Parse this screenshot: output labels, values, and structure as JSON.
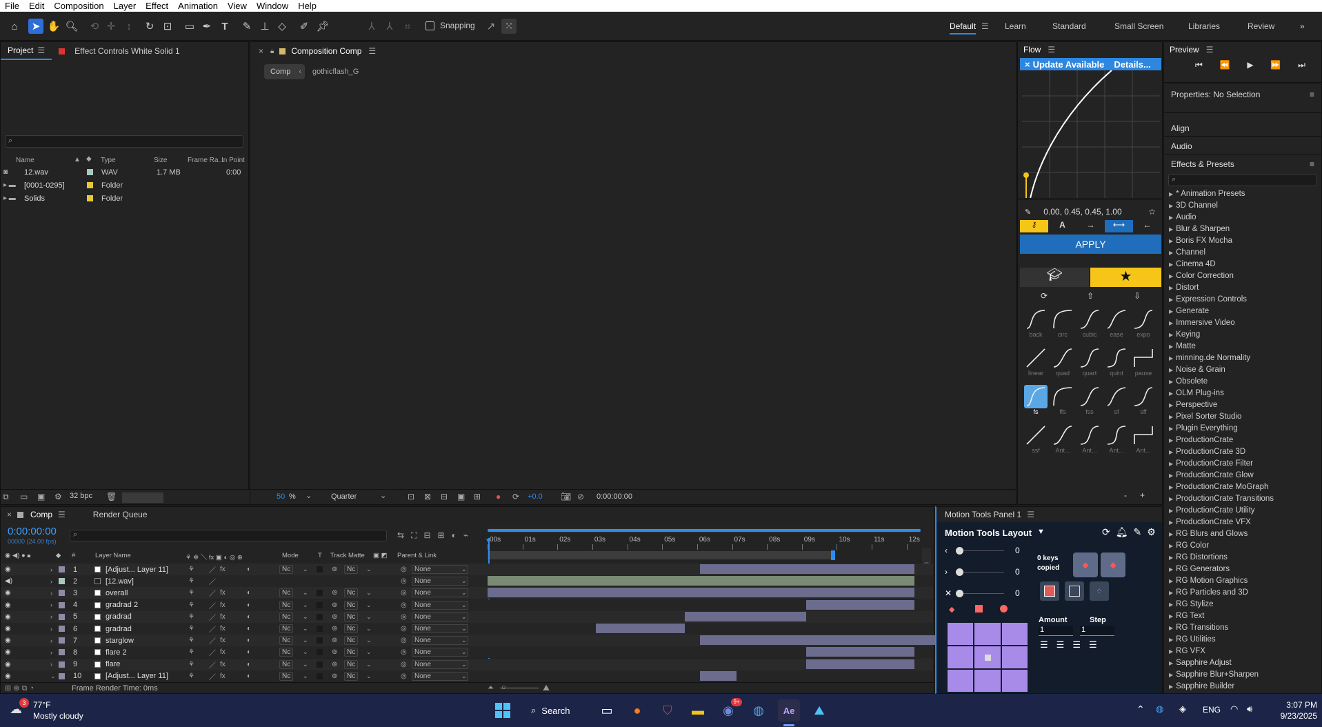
{
  "menu": [
    "File",
    "Edit",
    "Composition",
    "Layer",
    "Effect",
    "Animation",
    "View",
    "Window",
    "Help"
  ],
  "toolbar": {
    "snapping": "Snapping",
    "workspaces": [
      "Default",
      "Learn",
      "Standard",
      "Small Screen",
      "Libraries",
      "Review"
    ]
  },
  "project": {
    "tab": "Project",
    "effect_tab": "Effect Controls White Solid 1",
    "columns": [
      "Name",
      "Type",
      "Size",
      "Frame Ra...",
      "In Point"
    ],
    "items": [
      {
        "name": "12.wav",
        "type": "WAV",
        "size": "1.7 MB",
        "in": "0:00",
        "color": "#a9c8c0"
      },
      {
        "name": "[0001-0295]",
        "type": "Folder",
        "size": "",
        "in": "",
        "color": "#e8c83a"
      },
      {
        "name": "Solids",
        "type": "Folder",
        "size": "",
        "in": "",
        "color": "#e8c83a"
      }
    ],
    "bpc": "32 bpc"
  },
  "comp": {
    "tab": "Composition Comp",
    "crumb1": "Comp",
    "crumb2": "gothicflash_G",
    "zoom": "50",
    "pct": "%",
    "res": "Quarter",
    "exposure": "+0.0",
    "time": "0:00:00:00"
  },
  "flow": {
    "title": "Flow",
    "update": "Update Available",
    "details": "Details...",
    "values": "0.00, 0.45, 0.45, 1.00",
    "apply": "APPLY",
    "eases": [
      "back",
      "circ",
      "cubic",
      "ease",
      "expo",
      "linear",
      "quad",
      "quart",
      "quint",
      "pause",
      "fs",
      "ffs",
      "fss",
      "sf",
      "sff",
      "ssf",
      "Ant...",
      "Ant...",
      "Ant...",
      "Ant..."
    ],
    "minus": "-",
    "plus": "+"
  },
  "preview": {
    "title": "Preview"
  },
  "props": {
    "title": "Properties: No Selection",
    "align": "Align",
    "audio": "Audio",
    "effects": "Effects & Presets",
    "list": [
      "* Animation Presets",
      "3D Channel",
      "Audio",
      "Blur & Sharpen",
      "Boris FX Mocha",
      "Channel",
      "Cinema 4D",
      "Color Correction",
      "Distort",
      "Expression Controls",
      "Generate",
      "Immersive Video",
      "Keying",
      "Matte",
      "minning.de Normality",
      "Noise & Grain",
      "Obsolete",
      "OLM Plug-ins",
      "Perspective",
      "Pixel Sorter Studio",
      "Plugin Everything",
      "ProductionCrate",
      "ProductionCrate 3D",
      "ProductionCrate Filter",
      "ProductionCrate Glow",
      "ProductionCrate MoGraph",
      "ProductionCrate Transitions",
      "ProductionCrate Utility",
      "ProductionCrate VFX",
      "RG Blurs and Glows",
      "RG Color",
      "RG Distortions",
      "RG Generators",
      "RG Motion Graphics",
      "RG Particles and 3D",
      "RG Stylize",
      "RG Text",
      "RG Transitions",
      "RG Utilities",
      "RG VFX",
      "Sapphire Adjust",
      "Sapphire Blur+Sharpen",
      "Sapphire Builder"
    ]
  },
  "timeline": {
    "tab": "Comp",
    "rq": "Render Queue",
    "time": "0:00:00:00",
    "fps": "00000 (24.00 fps)",
    "cols": {
      "hash": "#",
      "name": "Layer Name",
      "mode": "Mode",
      "t": "T",
      "matte": "Track Matte",
      "parent": "Parent & Link"
    },
    "ruler": [
      "00s",
      "01s",
      "02s",
      "03s",
      "04s",
      "05s",
      "06s",
      "07s",
      "08s",
      "09s",
      "10s",
      "11s",
      "12s"
    ],
    "layers": [
      {
        "n": "1",
        "name": "[Adjust... Layer 11]",
        "mode": "Nc",
        "matte": "Nc",
        "parent": "None",
        "color": "#8c8ca6",
        "s": 0.49,
        "e": 0.985
      },
      {
        "n": "2",
        "name": "[12.wav]",
        "mode": "",
        "matte": "",
        "parent": "None",
        "color": "#a9c8c0",
        "s": 0,
        "e": 0.985
      },
      {
        "n": "3",
        "name": "overall",
        "mode": "Nc",
        "matte": "Nc",
        "parent": "None",
        "color": "#8c8ca6",
        "s": 0,
        "e": 0.985
      },
      {
        "n": "4",
        "name": "gradrad 2",
        "mode": "Nc",
        "matte": "Nc",
        "parent": "None",
        "color": "#8c8ca6",
        "s": 0.735,
        "e": 0.985
      },
      {
        "n": "5",
        "name": "gradrad",
        "mode": "Nc",
        "matte": "Nc",
        "parent": "None",
        "color": "#8c8ca6",
        "s": 0.455,
        "e": 0.735
      },
      {
        "n": "6",
        "name": "gradrad",
        "mode": "Nc",
        "matte": "Nc",
        "parent": "None",
        "color": "#8c8ca6",
        "s": 0.25,
        "e": 0.455
      },
      {
        "n": "7",
        "name": "starglow",
        "mode": "Nc",
        "matte": "Nc",
        "parent": "None",
        "color": "#8c8ca6",
        "s": 0.49,
        "e": 1.11
      },
      {
        "n": "8",
        "name": "flare 2",
        "mode": "Nc",
        "matte": "Nc",
        "parent": "None",
        "color": "#8c8ca6",
        "s": 0.735,
        "e": 0.985
      },
      {
        "n": "9",
        "name": "flare",
        "mode": "Nc",
        "matte": "Nc",
        "parent": "None",
        "color": "#8c8ca6",
        "s": 0.735,
        "e": 0.985
      },
      {
        "n": "10",
        "name": "[Adjust... Layer 11]",
        "mode": "Nc",
        "matte": "Nc",
        "parent": "None",
        "color": "#8c8ca6",
        "s": 0.49,
        "e": 0.575
      }
    ],
    "render_time": "Frame Render Time: 0ms"
  },
  "motion": {
    "title": "Motion Tools Panel 1",
    "layout": "Motion Tools Layout",
    "v1": "0",
    "v2": "0",
    "v3": "0",
    "keys": "0 keys copied",
    "amount": "Amount",
    "step": "Step",
    "amount_val": "1",
    "step_val": "1"
  },
  "taskbar": {
    "temp": "77°F",
    "weather": "Mostly cloudy",
    "badge": "3",
    "search": "Search",
    "lang": "ENG",
    "time": "3:07 PM",
    "date": "9/23/2025",
    "discord_badge": "9+"
  }
}
